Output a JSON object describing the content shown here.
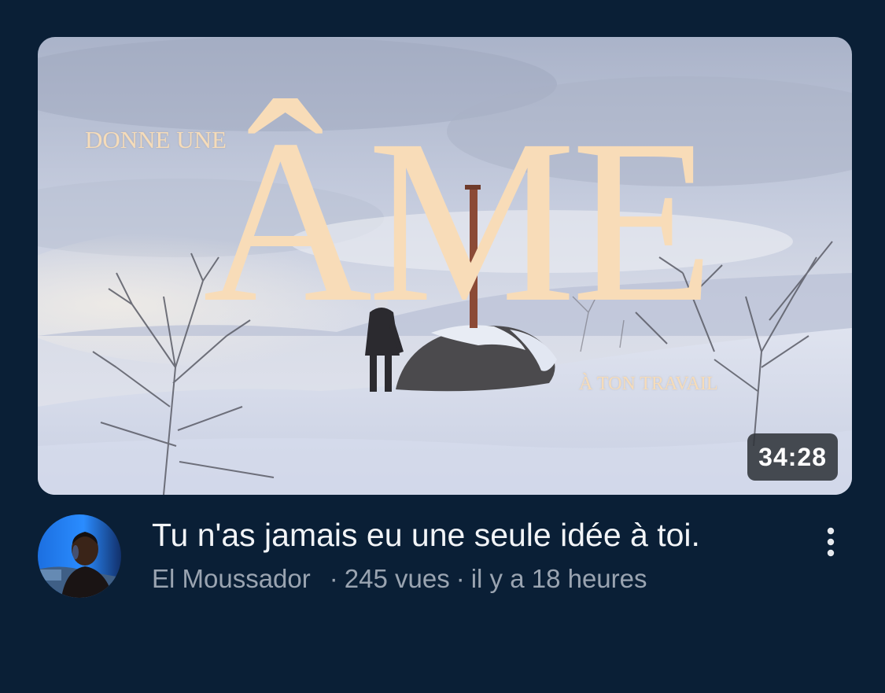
{
  "video": {
    "thumbnail": {
      "top_text": "DONNE UNE",
      "big_text": "ÂME",
      "bottom_text": "À TON TRAVAIL"
    },
    "duration": "34:28",
    "title": "Tu n'as jamais eu une seule idée à toi.",
    "channel": "El Moussador",
    "views": "245 vues",
    "age": "il y a 18 heures",
    "separator": "·",
    "more_icon": "vertical-ellipsis-icon"
  },
  "colors": {
    "background": "#0a1f36",
    "title_text": "#f2f4f7",
    "meta_text": "#9aa4b1",
    "thumb_lettering": "#f8dcb8",
    "duration_badge": "#30343a"
  }
}
